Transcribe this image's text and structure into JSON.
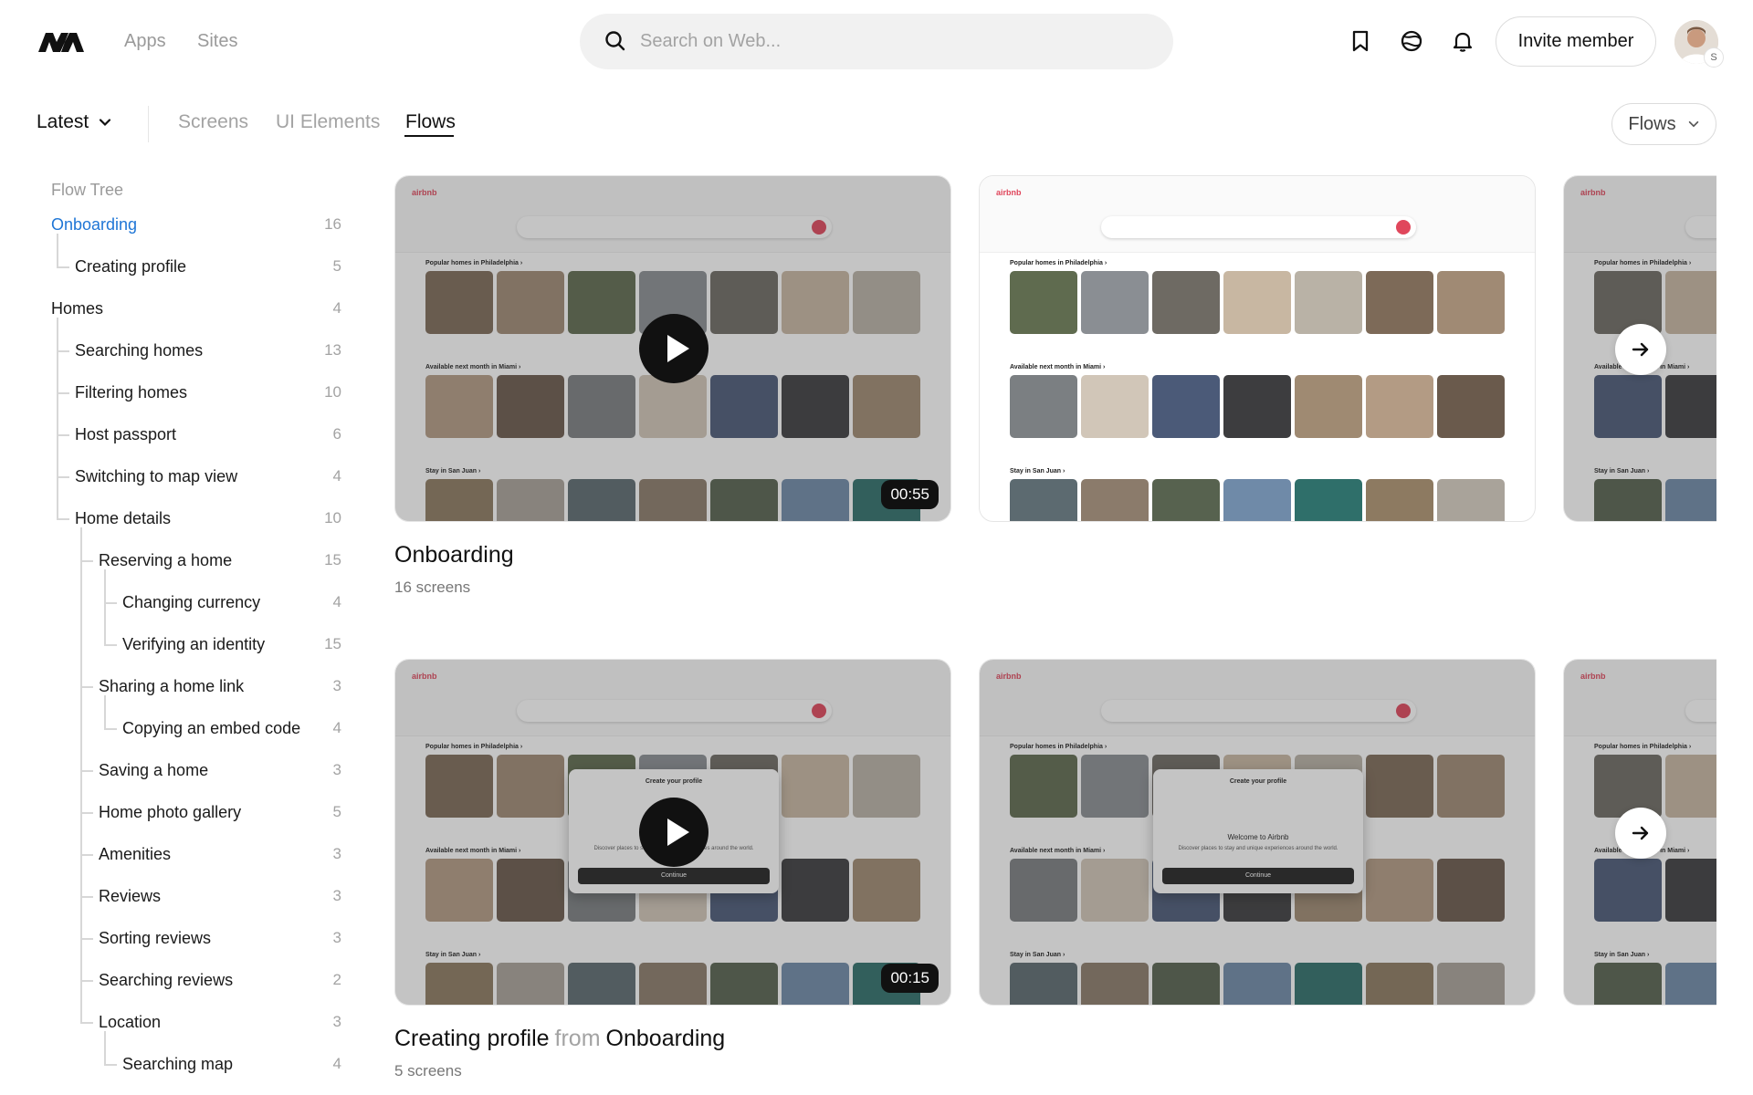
{
  "header": {
    "nav": [
      "Apps",
      "Sites"
    ],
    "search_placeholder": "Search on Web...",
    "invite_label": "Invite member",
    "avatar_badge": "S"
  },
  "subheader": {
    "latest_label": "Latest",
    "tabs": [
      "Screens",
      "UI Elements",
      "Flows"
    ],
    "active_tab": "Flows",
    "filter_label": "Flows"
  },
  "sidebar": {
    "title": "Flow Tree",
    "items": [
      {
        "label": "Onboarding",
        "count": "16",
        "depth": 0,
        "active": true
      },
      {
        "label": "Creating profile",
        "count": "5",
        "depth": 1
      },
      {
        "label": "Homes",
        "count": "4",
        "depth": 0
      },
      {
        "label": "Searching homes",
        "count": "13",
        "depth": 1
      },
      {
        "label": "Filtering homes",
        "count": "10",
        "depth": 1
      },
      {
        "label": "Host passport",
        "count": "6",
        "depth": 1
      },
      {
        "label": "Switching to map view",
        "count": "4",
        "depth": 1
      },
      {
        "label": "Home details",
        "count": "10",
        "depth": 1
      },
      {
        "label": "Reserving a home",
        "count": "15",
        "depth": 2
      },
      {
        "label": "Changing currency",
        "count": "4",
        "depth": 3
      },
      {
        "label": "Verifying an identity",
        "count": "15",
        "depth": 3
      },
      {
        "label": "Sharing a home link",
        "count": "3",
        "depth": 2
      },
      {
        "label": "Copying an embed code",
        "count": "4",
        "depth": 3
      },
      {
        "label": "Saving a home",
        "count": "3",
        "depth": 2
      },
      {
        "label": "Home photo gallery",
        "count": "5",
        "depth": 2
      },
      {
        "label": "Amenities",
        "count": "3",
        "depth": 2
      },
      {
        "label": "Reviews",
        "count": "3",
        "depth": 2
      },
      {
        "label": "Sorting reviews",
        "count": "3",
        "depth": 2
      },
      {
        "label": "Searching reviews",
        "count": "2",
        "depth": 2
      },
      {
        "label": "Location",
        "count": "3",
        "depth": 2
      },
      {
        "label": "Searching map",
        "count": "4",
        "depth": 3
      }
    ]
  },
  "mock": {
    "brand": "airbnb",
    "row1": "Popular homes in Philadelphia ›",
    "row2": "Available next month in Miami ›",
    "row3": "Stay in San Juan ›",
    "modal_title": "Create your profile",
    "modal_welcome": "Welcome to Airbnb",
    "modal_sub": "Discover places to stay and unique experiences around the world.",
    "modal_button": "Continue"
  },
  "flows": [
    {
      "title": "Onboarding",
      "from": "",
      "parent": "",
      "subtitle": "16 screens",
      "duration": "00:55"
    },
    {
      "title": "Creating profile",
      "from": "from",
      "parent": "Onboarding",
      "subtitle": "5 screens",
      "duration": "00:15"
    }
  ],
  "colors": {
    "accent_blue": "#1f76d6",
    "airbnb_red": "#e0475c",
    "muted": "#a3a3a3"
  }
}
